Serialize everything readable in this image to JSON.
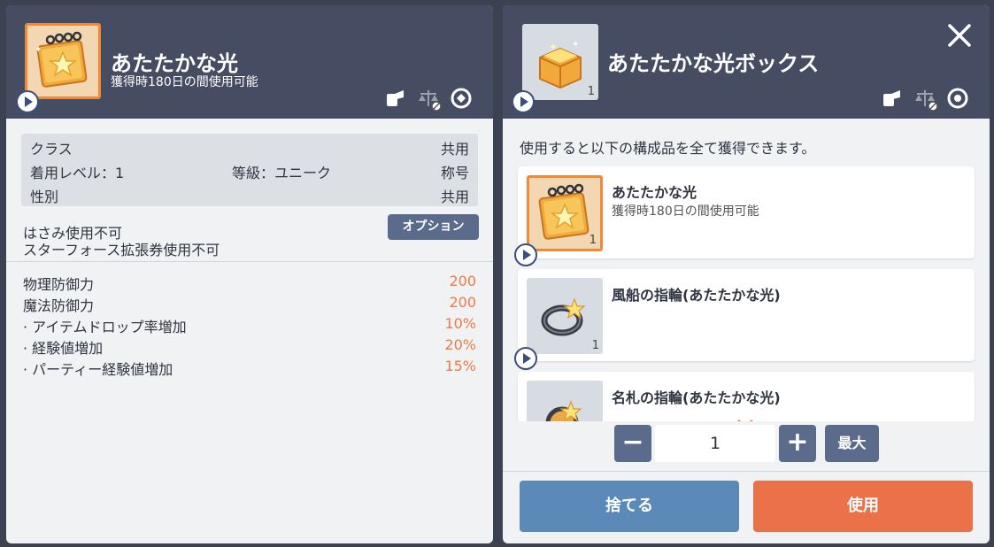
{
  "left": {
    "title": "あたたかな光",
    "subtitle": "獲得時180日の間使用可能",
    "header_icons": [
      "hand-icon",
      "scale-icon",
      "recycle-icon"
    ],
    "stats_box": {
      "row1_label": "クラス",
      "row1_value": "共用",
      "row2_label": "着用レベル：1",
      "row2_middle": "等級：ユニーク",
      "row2_value": "称号",
      "row3_label": "性別",
      "row3_value": "共用"
    },
    "notes": {
      "line1": "はさみ使用不可",
      "line2": "スターフォース拡張券使用不可"
    },
    "option_button": "オプション",
    "attributes": [
      {
        "label": "物理防御力",
        "value": "200"
      },
      {
        "label": "魔法防御力",
        "value": "200"
      },
      {
        "label": "· アイテムドロップ率増加",
        "value": "10%"
      },
      {
        "label": "· 経験値増加",
        "value": "20%"
      },
      {
        "label": "· パーティー経験値増加",
        "value": "15%"
      }
    ]
  },
  "right": {
    "title": "あたたかな光ボックス",
    "item_count": "1",
    "close_icon": "close-icon",
    "header_icons": [
      "hand-icon",
      "scale-icon",
      "target-icon"
    ],
    "description": "使用すると以下の構成品を全て獲得できます。",
    "items": [
      {
        "name": "あたたかな光",
        "sub": "獲得時180日の間使用可能",
        "count": "1"
      },
      {
        "name": "風船の指輪(あたたかな光)",
        "sub": "",
        "count": "1"
      },
      {
        "name": "名札の指輪(あたたかな光)",
        "sub": "",
        "count": ""
      }
    ],
    "quantity": {
      "minus": "−",
      "value": "1",
      "plus": "+",
      "max": "最大"
    },
    "discard_button": "捨てる",
    "use_button": "使用",
    "colors": {
      "discard": "#5b89b8",
      "use": "#ea7148",
      "header": "#464c61",
      "accent": "#ef7a45"
    }
  }
}
